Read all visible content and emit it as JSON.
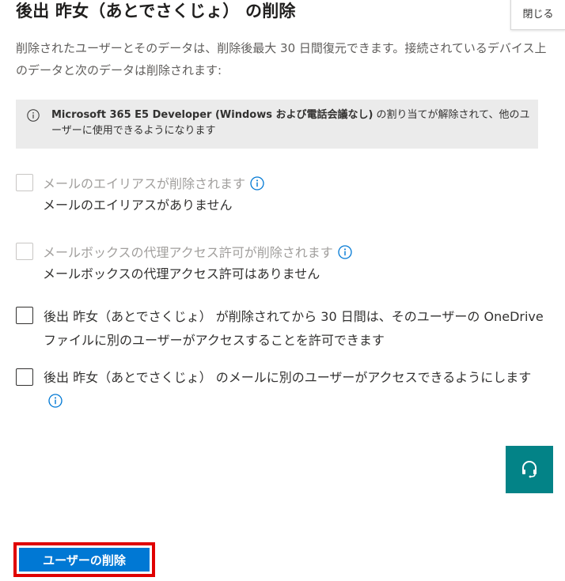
{
  "header": {
    "title": "後出 昨女（あとでさくじょ） の削除",
    "close_label": "閉じる"
  },
  "description": "削除されたユーザーとそのデータは、削除後最大 30 日間復元できます。接続されているデバイス上のデータと次のデータは削除されます:",
  "info": {
    "license_name": "Microsoft 365 E5 Developer (Windows および電話会議なし)",
    "message": " の割り当てが解除されて、他のユーザーに使用できるようになります"
  },
  "options": [
    {
      "label": "メールのエイリアスが削除されます",
      "sublabel": "メールのエイリアスがありません",
      "disabled": true,
      "checked": false
    },
    {
      "label": "メールボックスの代理アクセス許可が削除されます",
      "sublabel": "メールボックスの代理アクセス許可はありません",
      "disabled": true,
      "checked": false
    },
    {
      "label": "後出 昨女（あとでさくじょ） が削除されてから 30 日間は、そのユーザーの OneDrive ファイルに別のユーザーがアクセスすることを許可できます",
      "disabled": false,
      "checked": false
    },
    {
      "label": "後出 昨女（あとでさくじょ） のメールに別のユーザーがアクセスできるようにします",
      "disabled": false,
      "checked": false
    }
  ],
  "footer": {
    "delete_label": "ユーザーの削除"
  },
  "colors": {
    "primary": "#0078d4",
    "help_fab": "#038387",
    "highlight_border": "#e00000",
    "info_bg": "#ebebeb"
  },
  "icons": {
    "info": "info-icon",
    "help": "headset-icon"
  }
}
